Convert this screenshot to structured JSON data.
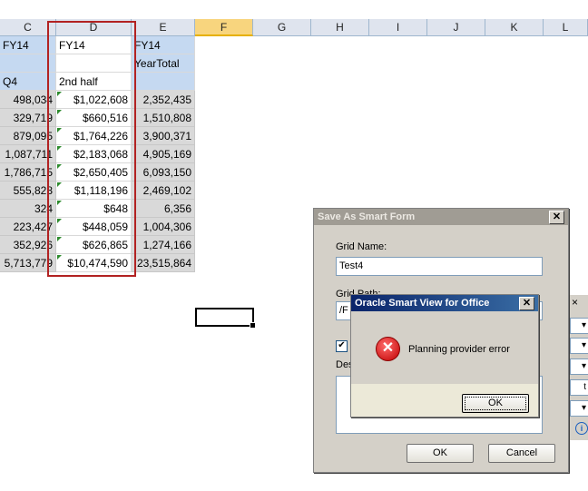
{
  "columns": [
    "C",
    "D",
    "E",
    "F",
    "G",
    "H",
    "I",
    "J",
    "K",
    "L"
  ],
  "header_rows": {
    "row1": {
      "c": "FY14",
      "d": "FY14",
      "e": "FY14"
    },
    "row2": {
      "e": "YearTotal"
    },
    "row3": {
      "c": "Q4",
      "d": "2nd half"
    }
  },
  "data_rows": [
    {
      "c": "498,034",
      "d": "$1,022,608",
      "e": "2,352,435"
    },
    {
      "c": "329,719",
      "d": "$660,516",
      "e": "1,510,808"
    },
    {
      "c": "879,095",
      "d": "$1,764,226",
      "e": "3,900,371"
    },
    {
      "c": "1,087,711",
      "d": "$2,183,068",
      "e": "4,905,169"
    },
    {
      "c": "1,786,715",
      "d": "$2,650,405",
      "e": "6,093,150"
    },
    {
      "c": "555,828",
      "d": "$1,118,196",
      "e": "2,469,102"
    },
    {
      "c": "324",
      "d": "$648",
      "e": "6,356"
    },
    {
      "c": "223,427",
      "d": "$448,059",
      "e": "1,004,306"
    },
    {
      "c": "352,926",
      "d": "$626,865",
      "e": "1,274,166"
    },
    {
      "c": "5,713,779",
      "d": "$10,474,590",
      "e": "23,515,864"
    }
  ],
  "save_dialog": {
    "title": "Save As Smart Form",
    "close": "✕",
    "grid_name_label": "Grid Name:",
    "grid_name_value": "Test4",
    "grid_path_label": "Grid Path:",
    "grid_path_value": "/F",
    "desc_label": "Des",
    "ok": "OK",
    "cancel": "Cancel"
  },
  "error_dialog": {
    "title": "Oracle Smart View for Office",
    "close": "✕",
    "message": "Planning provider error",
    "ok": "OK"
  },
  "side_panel": {
    "close": "×",
    "partial_text": "t"
  },
  "colors": {
    "header_bg": "#c5d9f1",
    "data_bg": "#d9d9d9",
    "highlight": "#b22222",
    "title_active": "#0a246a",
    "error_icon": "#d01f1f"
  }
}
